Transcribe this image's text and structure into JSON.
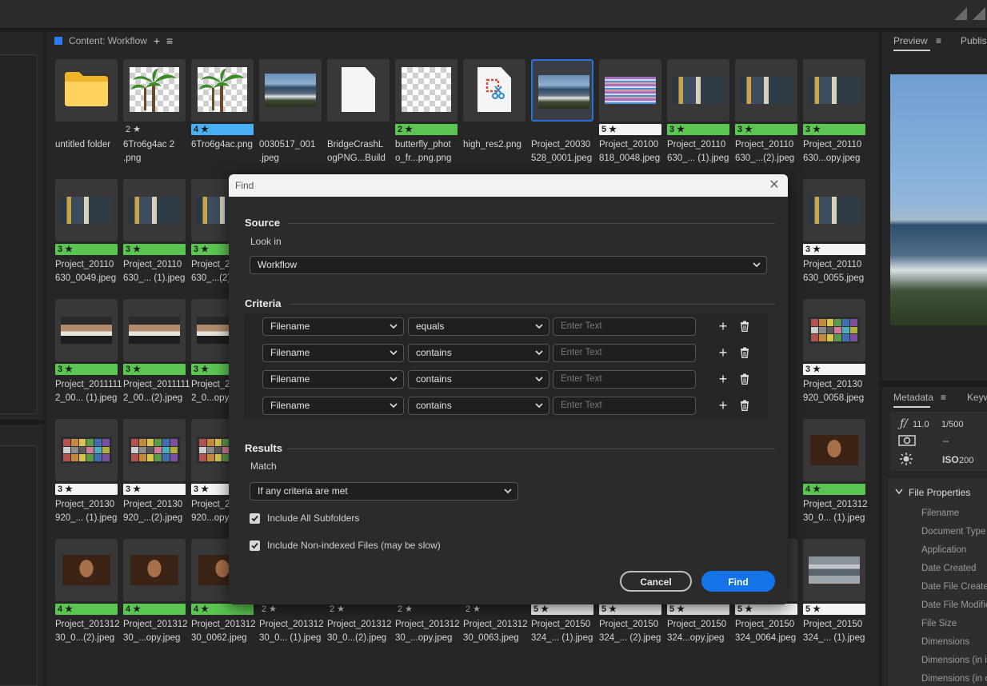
{
  "content_panel": {
    "title": "Content: Workflow"
  },
  "tiles": [
    {
      "kind": "folder",
      "rating": "",
      "rating_style": "n",
      "name": "untitled folder"
    },
    {
      "kind": "palm",
      "rating": "2 ★",
      "rating_style": "n",
      "name": "6Tro6g4ac 2\n.png"
    },
    {
      "kind": "palm",
      "rating": "4 ★",
      "rating_style": "b",
      "name": "6Tro6g4ac.png"
    },
    {
      "kind": "sea",
      "rating": "",
      "rating_style": "n",
      "name": "0030517_001\n.jpeg"
    },
    {
      "kind": "doc",
      "rating": "",
      "rating_style": "n",
      "name": "BridgeCrashL\nogPNG...Build"
    },
    {
      "kind": "checker",
      "rating": "2 ★",
      "rating_style": "g",
      "name": "butterfly_phot\no_fr...png.png"
    },
    {
      "kind": "pdf",
      "rating": "",
      "rating_style": "n",
      "name": "high_res2.png"
    },
    {
      "kind": "sea",
      "rating": "",
      "rating_style": "n",
      "name": "Project_20030\n528_0001.jpeg",
      "selected": true
    },
    {
      "kind": "stripes",
      "rating": "5 ★",
      "rating_style": "w",
      "name": "Project_20100\n818_0048.jpeg"
    },
    {
      "kind": "room",
      "rating": "3 ★",
      "rating_style": "g",
      "name": "Project_20110\n630_... (1).jpeg"
    },
    {
      "kind": "room",
      "rating": "3 ★",
      "rating_style": "g",
      "name": "Project_20110\n630_...(2).jpeg"
    },
    {
      "kind": "room",
      "rating": "3 ★",
      "rating_style": "g",
      "name": "Project_20110\n630...opy.jpeg"
    },
    {
      "kind": "room",
      "rating": "3 ★",
      "rating_style": "g",
      "name": "Project_20110\n630_0049.jpeg"
    },
    {
      "kind": "room",
      "rating": "3 ★",
      "rating_style": "g",
      "name": "Project_20110\n630_... (1).jpeg"
    },
    {
      "kind": "room",
      "rating": "3 ★",
      "rating_style": "g",
      "name": "Project_20110\n630_...(2)..."
    },
    {
      "kind": "room",
      "rating": "3 ★",
      "rating_style": "w",
      "name": "Project_20110\n630_0055.jpeg",
      "col": 11
    },
    {
      "kind": "people",
      "rating": "3 ★",
      "rating_style": "g",
      "name": "Project_2011111\n2_00... (1).jpeg"
    },
    {
      "kind": "people",
      "rating": "3 ★",
      "rating_style": "g",
      "name": "Project_2011111\n2_00...(2).jpeg"
    },
    {
      "kind": "people",
      "rating": "3 ★",
      "rating_style": "g",
      "name": "Project_2...\n2_0...opy.jpeg"
    },
    {
      "kind": "chart",
      "rating": "3 ★",
      "rating_style": "w",
      "name": "Project_20130\n920_0058.jpeg",
      "col": 11
    },
    {
      "kind": "chart",
      "rating": "3 ★",
      "rating_style": "w",
      "name": "Project_20130\n920_... (1).jpeg"
    },
    {
      "kind": "chart",
      "rating": "3 ★",
      "rating_style": "w",
      "name": "Project_20130\n920_...(2).jpeg"
    },
    {
      "kind": "chart",
      "rating": "3 ★",
      "rating_style": "w",
      "name": "Project_2...\n920...opy.jpeg"
    },
    {
      "kind": "woman",
      "rating": "4 ★",
      "rating_style": "g",
      "name": "Project_201312\n30_0... (1).jpeg",
      "col": 11
    },
    {
      "kind": "woman",
      "rating": "4 ★",
      "rating_style": "g",
      "name": "Project_201312\n30_0...(2).jpeg"
    },
    {
      "kind": "woman",
      "rating": "4 ★",
      "rating_style": "g",
      "name": "Project_201312\n30_...opy.jpeg"
    },
    {
      "kind": "woman",
      "rating": "4 ★",
      "rating_style": "g",
      "name": "Project_201312\n30_0062.jpeg"
    },
    {
      "kind": "none",
      "rating": "2 ★",
      "rating_style": "n",
      "name": "Project_201312\n30_0... (1).jpeg"
    },
    {
      "kind": "none",
      "rating": "2 ★",
      "rating_style": "n",
      "name": "Project_201312\n30_0...(2).jpeg"
    },
    {
      "kind": "none",
      "rating": "2 ★",
      "rating_style": "n",
      "name": "Project_201312\n30_...opy.jpeg"
    },
    {
      "kind": "none",
      "rating": "2 ★",
      "rating_style": "n",
      "name": "Project_201312\n30_0063.jpeg"
    },
    {
      "kind": "none",
      "rating": "5 ★",
      "rating_style": "w",
      "name": "Project_20150\n324_... (1).jpeg"
    },
    {
      "kind": "none",
      "rating": "5 ★",
      "rating_style": "w",
      "name": "Project_20150\n324_... (2).jpeg"
    },
    {
      "kind": "none",
      "rating": "5 ★",
      "rating_style": "w",
      "name": "Project_20150\n324...opy.jpeg"
    },
    {
      "kind": "none",
      "rating": "5 ★",
      "rating_style": "w",
      "name": "Project_20150\n324_0064.jpeg"
    },
    {
      "kind": "rail",
      "rating": "5 ★",
      "rating_style": "w",
      "name": "Project_20150\n324_... (1).jpeg"
    }
  ],
  "right_panel": {
    "preview_tab": "Preview",
    "publish_tab": "Publish",
    "metadata_tab": "Metadata",
    "keywords_tab": "Keyw",
    "aperture": "11.0",
    "aperture_prefix": "ƒ/",
    "shutter": "1/500",
    "metering": "--",
    "iso_label": "ISO",
    "iso": "200",
    "file_properties": "File Properties",
    "fields": [
      "Filename",
      "Document Type",
      "Application",
      "Date Created",
      "Date File Create",
      "Date File Modifie",
      "File Size",
      "Dimensions",
      "Dimensions (in i",
      "Dimensions (in c"
    ]
  },
  "dialog": {
    "title": "Find",
    "source_title": "Source",
    "look_in_label": "Look in",
    "look_in_value": "Workflow",
    "criteria_title": "Criteria",
    "criteria": [
      {
        "field": "Filename",
        "op": "equals",
        "placeholder": "Enter Text"
      },
      {
        "field": "Filename",
        "op": "contains",
        "placeholder": "Enter Text"
      },
      {
        "field": "Filename",
        "op": "contains",
        "placeholder": "Enter Text"
      },
      {
        "field": "Filename",
        "op": "contains",
        "placeholder": "Enter Text"
      }
    ],
    "results_title": "Results",
    "match_label": "Match",
    "match_value": "If any criteria are met",
    "include_subfolders": "Include All Subfolders",
    "include_nonindexed": "Include Non-indexed Files (may be slow)",
    "cancel": "Cancel",
    "find": "Find"
  },
  "colors": {
    "accent": "#1473e6",
    "rating_green": "#5bc551",
    "rating_blue": "#49aff5",
    "rating_white": "#f4f4f4"
  }
}
